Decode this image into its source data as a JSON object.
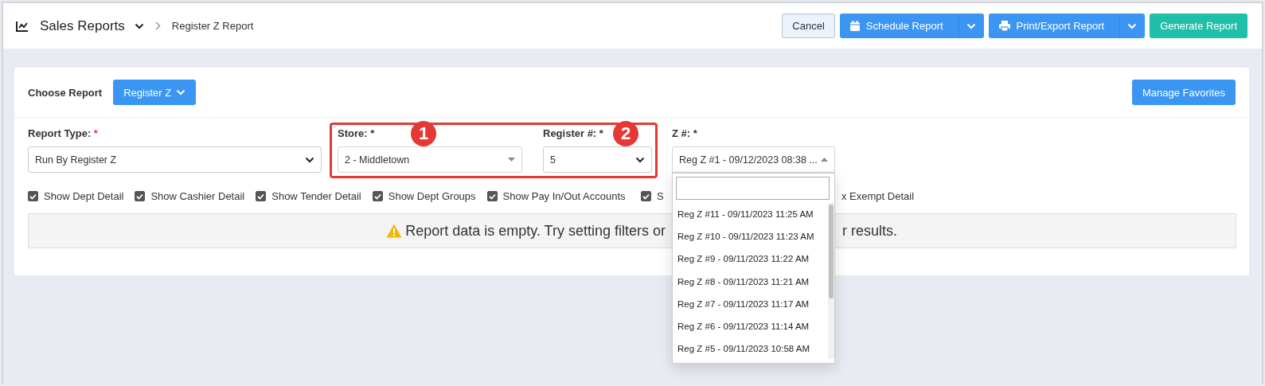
{
  "header": {
    "title": "Sales Reports",
    "breadcrumb": "Register Z Report",
    "buttons": [
      {
        "label": "Cancel",
        "kind": "outline"
      },
      {
        "label": "Schedule Report",
        "kind": "split"
      },
      {
        "label": "Print/Export Report",
        "kind": "split"
      },
      {
        "label": "Generate Report",
        "kind": "accent"
      }
    ]
  },
  "choose_report": {
    "label": "Choose Report",
    "button": "Register Z",
    "favorites_button": "Manage Favorites"
  },
  "filters": [
    {
      "label": "Report Type:",
      "required_mark": "*",
      "value": "Run By Register Z",
      "kind": "native"
    },
    {
      "label": "Store: *",
      "value": "2 - Middletown",
      "kind": "combo",
      "expanded": false
    },
    {
      "label": "Register #: *",
      "value": "5",
      "kind": "native"
    },
    {
      "label": "Z #: *",
      "value": "Reg Z #1 - 09/12/2023 08:38 ...",
      "kind": "combo",
      "expanded": true
    }
  ],
  "annotations": [
    {
      "label": "1"
    },
    {
      "label": "2"
    }
  ],
  "checkboxes": [
    {
      "label": "Show Dept Detail",
      "checked": true
    },
    {
      "label": "Show Cashier Detail",
      "checked": true
    },
    {
      "label": "Show Tender Detail",
      "checked": true
    },
    {
      "label": "Show Dept Groups",
      "checked": true
    },
    {
      "label": "Show Pay In/Out Accounts",
      "checked": true
    },
    {
      "label": "S",
      "checked": true
    }
  ],
  "checkbox_text_right": "x Exempt Detail",
  "message": {
    "parts": [
      "Report data is empty. Try setting filters or",
      "r results."
    ]
  },
  "z_options": [
    {
      "label": "Reg Z #11 - 09/11/2023 11:25 AM",
      "selected": false
    },
    {
      "label": "Reg Z #10 - 09/11/2023 11:23 AM",
      "selected": false
    },
    {
      "label": "Reg Z #9 - 09/11/2023 11:22 AM",
      "selected": false
    },
    {
      "label": "Reg Z #8 - 09/11/2023 11:21 AM",
      "selected": false
    },
    {
      "label": "Reg Z #7 - 09/11/2023 11:17 AM",
      "selected": false
    },
    {
      "label": "Reg Z #6 - 09/11/2023 11:14 AM",
      "selected": false
    },
    {
      "label": "Reg Z #5 - 09/11/2023 10:58 AM",
      "selected": false
    }
  ]
}
